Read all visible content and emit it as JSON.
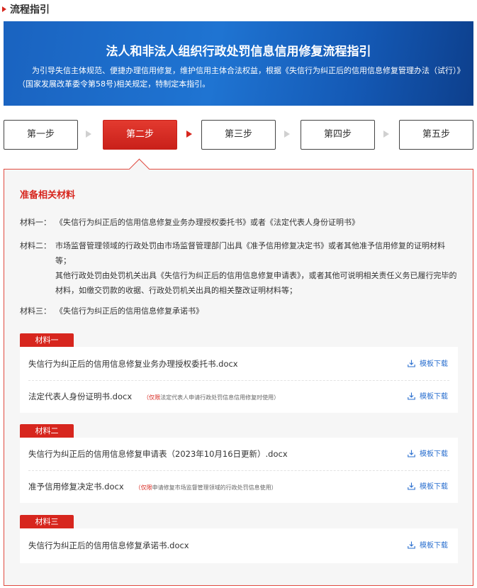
{
  "header": {
    "title": "流程指引"
  },
  "banner": {
    "title": "法人和非法人组织行政处罚信息信用修复流程指引",
    "description": "为引导失信主体规范、便捷办理信用修复，维护信用主体合法权益，根据《失信行为纠正后的信用信息修复管理办法（试行）》（国家发展改革委令第58号)相关规定，特制定本指引。"
  },
  "steps": [
    {
      "label": "第一步",
      "active": false
    },
    {
      "label": "第二步",
      "active": true
    },
    {
      "label": "第三步",
      "active": false
    },
    {
      "label": "第四步",
      "active": false
    },
    {
      "label": "第五步",
      "active": false
    }
  ],
  "section": {
    "title": "准备相关材料",
    "materials": [
      {
        "label": "材料一：",
        "lines": [
          "《失信行为纠正后的信用信息修复业务办理授权委托书》或者《法定代表人身份证明书》"
        ]
      },
      {
        "label": "材料二：",
        "lines": [
          "市场监督管理领域的行政处罚由市场监督管理部门出具《准予信用修复决定书》或者其他准予信用修复的证明材料等；",
          "其他行政处罚由处罚机关出具《失信行为纠正后的信用信息修复申请表》，或者其他可说明相关责任义务已履行完毕的材料，如缴交罚款的收据、行政处罚机关出具的相关整改证明材料等；"
        ]
      },
      {
        "label": "材料三：",
        "lines": [
          "《失信行为纠正后的信用信息修复承诺书》"
        ]
      }
    ]
  },
  "download_label": "模板下载",
  "groups": [
    {
      "tag": "材料一",
      "files": [
        {
          "name": "失信行为纠正后的信用信息修复业务办理授权委托书.docx",
          "note_prefix": "",
          "note": ""
        },
        {
          "name": "法定代表人身份证明书.docx",
          "note_prefix": "（仅限",
          "note": "法定代表人申请行政处罚信息信用修复时使用）"
        }
      ]
    },
    {
      "tag": "材料二",
      "files": [
        {
          "name": "失信行为纠正后的信用信息修复申请表（2023年10月16日更新）.docx",
          "note_prefix": "",
          "note": ""
        },
        {
          "name": "准予信用修复决定书.docx",
          "note_prefix": "（仅限",
          "note": "申请修复市场监督管理领域的行政处罚信息使用）"
        }
      ]
    },
    {
      "tag": "材料三",
      "files": [
        {
          "name": "失信行为纠正后的信用信息修复承诺书.docx",
          "note_prefix": "",
          "note": ""
        }
      ]
    }
  ],
  "colors": {
    "accent": "#d7261e",
    "banner": "#1f6fd0",
    "link": "#2a6fcf"
  }
}
